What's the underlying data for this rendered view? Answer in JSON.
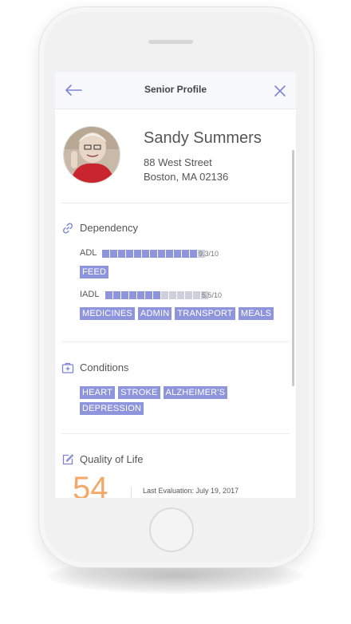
{
  "header": {
    "title": "Senior Profile",
    "back_icon": "arrow-left-icon",
    "close_icon": "close-icon"
  },
  "profile": {
    "name": "Sandy Summers",
    "address_line1": "88 West Street",
    "address_line2": "Boston, MA 02136"
  },
  "dependency": {
    "title": "Dependency",
    "icon": "link-icon",
    "adl": {
      "label": "ADL",
      "score_text": "9.3/10",
      "value": 9.3,
      "max": 10,
      "tags": [
        "FEED"
      ]
    },
    "iadl": {
      "label": "IADL",
      "score_text": "5.5/10",
      "value": 5.5,
      "max": 10,
      "tags": [
        "MEDICINES",
        "ADMIN",
        "TRANSPORT",
        "MEALS"
      ]
    }
  },
  "conditions": {
    "title": "Conditions",
    "icon": "medical-kit-icon",
    "tags": [
      "HEART",
      "STROKE",
      "ALZHEIMER'S",
      "DEPRESSION"
    ]
  },
  "quality_of_life": {
    "title": "Quality of Life",
    "icon": "edit-icon",
    "score": "54",
    "last_evaluation": "Last Evaluation: July 19, 2017"
  },
  "colors": {
    "accent": "#8f95dd",
    "bar_filled": "#8f95dd",
    "bar_empty": "#cdd0dc",
    "score": "#f4a867"
  }
}
